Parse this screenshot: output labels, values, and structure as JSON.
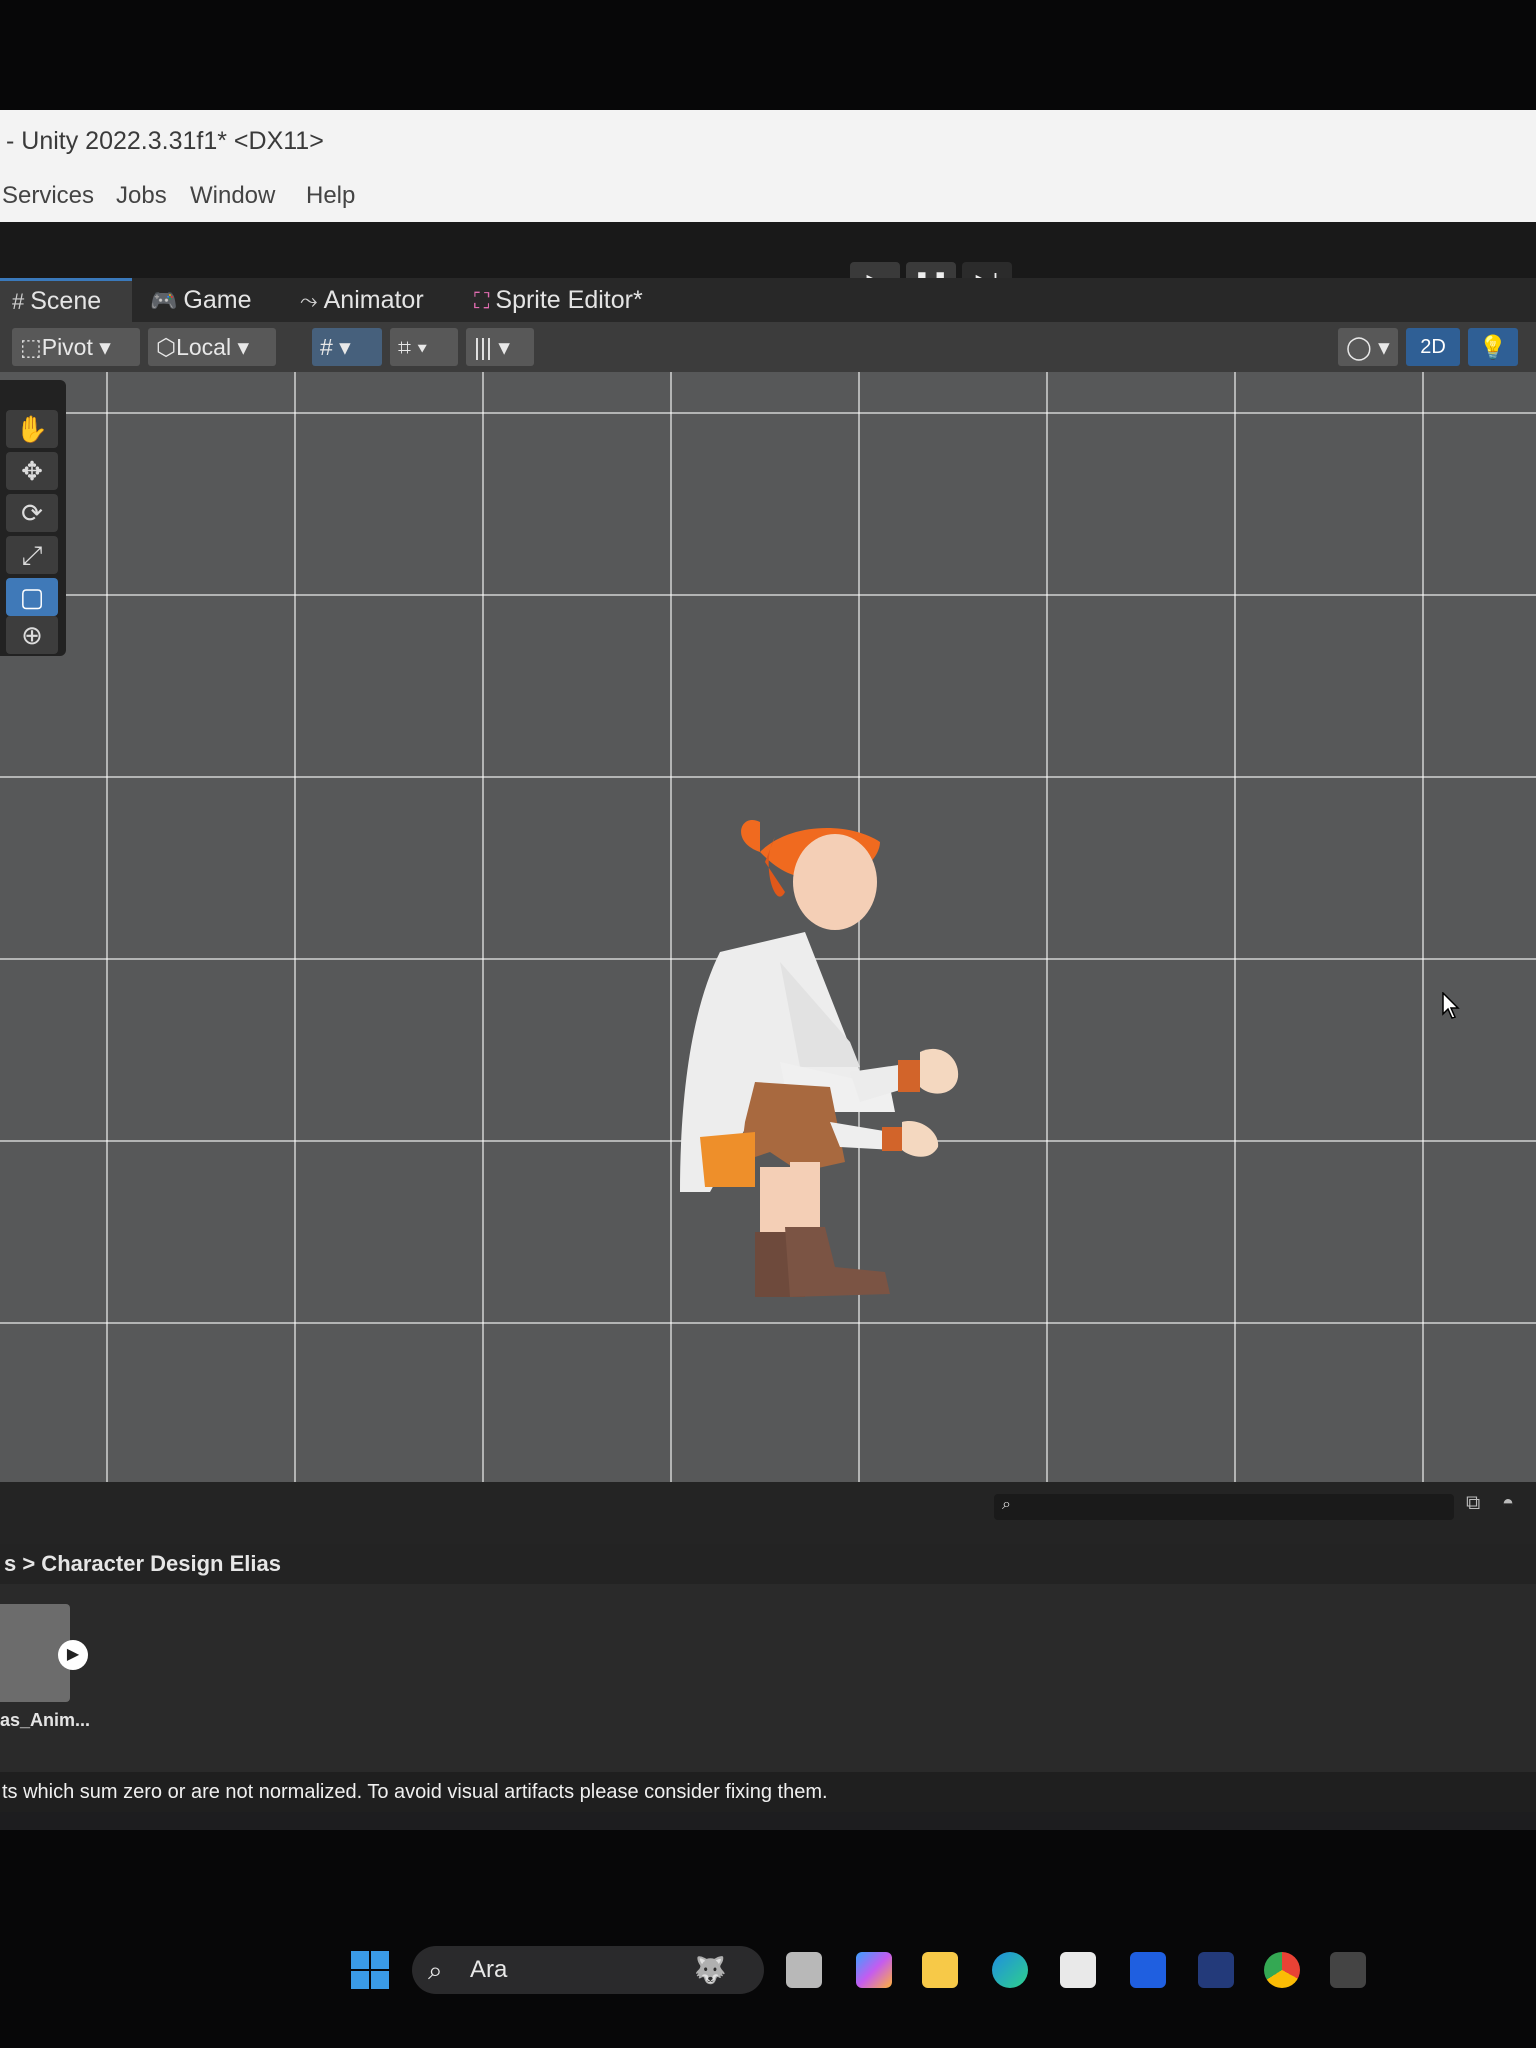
{
  "window": {
    "title": "- Unity 2022.3.31f1* <DX11>"
  },
  "menu": [
    "Services",
    "Jobs",
    "Window",
    "Help"
  ],
  "tabs": {
    "scene": "Scene",
    "game": "Game",
    "animator": "Animator",
    "sprite_editor": "Sprite Editor*"
  },
  "scene_toolbar": {
    "pivot": "Pivot",
    "local": "Local",
    "mode_2d": "2D"
  },
  "project": {
    "breadcrumb": "s > Character Design Elias",
    "asset_name": "as_Anim..."
  },
  "console": {
    "message": "ts which sum zero or are not normalized. To avoid visual artifacts please consider fixing them."
  },
  "taskbar": {
    "search_text": "Ara"
  },
  "colors": {
    "accent": "#3a79bb",
    "viewport_bg": "#575859",
    "hair": "#f06a1f",
    "coat": "#efefef",
    "shorts": "#a8693f",
    "boots": "#7b5444"
  }
}
